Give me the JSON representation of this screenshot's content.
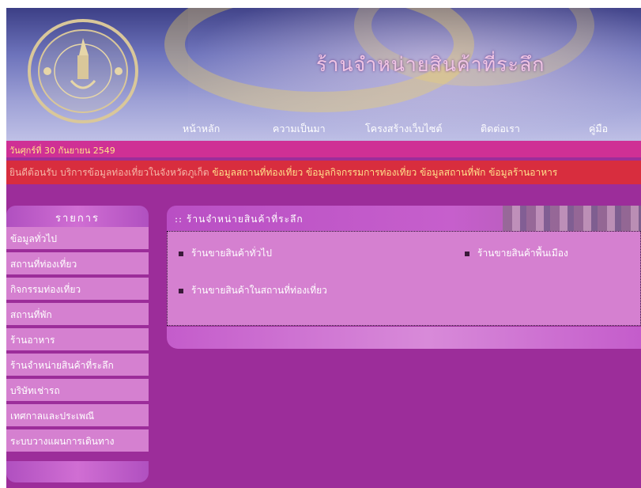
{
  "header": {
    "site_title": "ร้านจำหน่ายสินค้าที่ระลึก",
    "logo_alt": "ตราคณะวิทยาการสารสนเทศ มหาวิทยาลัยมหิดล"
  },
  "nav": {
    "items": [
      {
        "label": "หน้าหลัก"
      },
      {
        "label": "ความเป็นมา"
      },
      {
        "label": "โครงสร้างเว็บไซต์"
      },
      {
        "label": "ติดต่อเรา"
      },
      {
        "label": "คู่มือ"
      }
    ]
  },
  "date_text": "วันศุกร์ที่ 30 กันยายน 2549",
  "ticker": {
    "welcome": "ยินดีต้อนรับ บริการข้อมูลท่องเที่ยวในจังหวัดภูเก็ต",
    "links": "ข้อมูลสถานที่ท่องเที่ยว  ข้อมูลกิจกรรมการท่องเที่ยว  ข้อมูลสถานที่พัก  ข้อมูลร้านอาหาร"
  },
  "sidebar": {
    "title": "รายการ",
    "items": [
      {
        "label": "ข้อมูลทั่วไป"
      },
      {
        "label": "สถานที่ท่องเที่ยว"
      },
      {
        "label": "กิจกรรมท่องเที่ยว"
      },
      {
        "label": "สถานที่พัก"
      },
      {
        "label": "ร้านอาหาร"
      },
      {
        "label": "ร้านจำหน่ายสินค้าที่ระลึก"
      },
      {
        "label": "บริษัทเช่ารถ"
      },
      {
        "label": "เทศกาลและประเพณี"
      },
      {
        "label": "ระบบวางแผนการเดินทาง"
      }
    ]
  },
  "content": {
    "title": ":: ร้านจำหน่ายสินค้าที่ระลึก",
    "links": [
      {
        "label": "ร้านขายสินค้าทั่วไป"
      },
      {
        "label": "ร้านขายสินค้าพื้นเมือง"
      },
      {
        "label": "ร้านขายสินค้าในสถานที่ท่องเที่ยว"
      }
    ]
  },
  "colors": {
    "background": "#9c2d9a",
    "menu_item": "#d580d0",
    "date_bar": "#cf3095",
    "ticker_bar": "#d82d3e",
    "ticker_text": "#ffe08a"
  }
}
